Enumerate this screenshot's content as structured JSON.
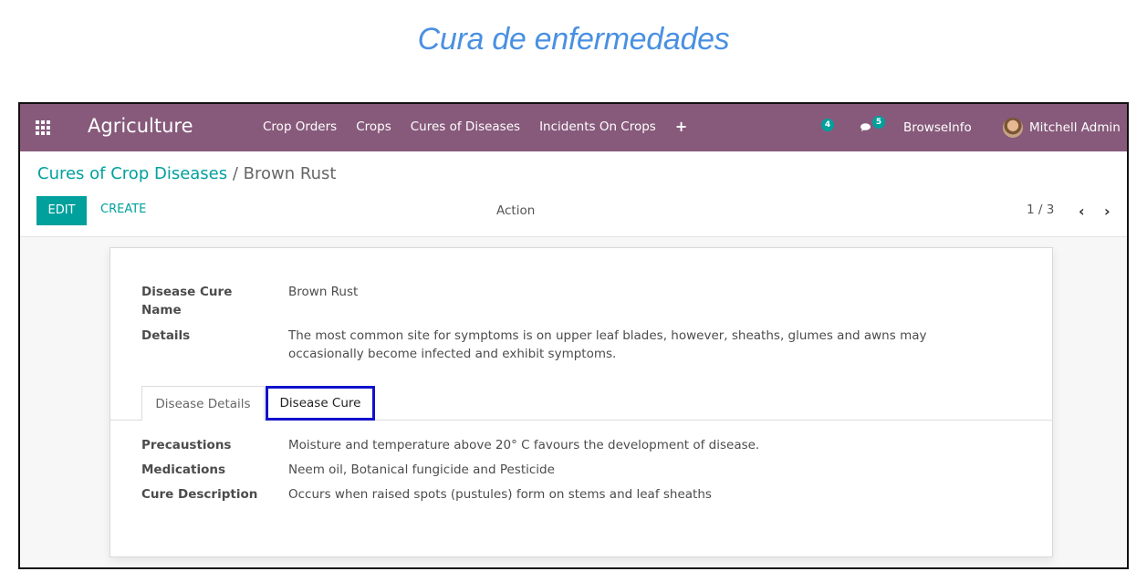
{
  "page": {
    "heading": "Cura de enfermedades"
  },
  "navbar": {
    "brand": "Agriculture",
    "menu": [
      "Crop Orders",
      "Crops",
      "Cures of Diseases",
      "Incidents On Crops"
    ],
    "add_icon": "+",
    "activity_count": "4",
    "message_count": "5",
    "company": "BrowseInfo",
    "user": "Mitchell Admin",
    "colors": {
      "bar": "#875a7b",
      "badge": "#00a09d"
    }
  },
  "control": {
    "breadcrumb_parent": "Cures of Crop Diseases",
    "breadcrumb_separator": " / ",
    "breadcrumb_current": "Brown Rust",
    "edit_label": "EDIT",
    "create_label": "CREATE",
    "action_label": "Action",
    "pager": "1 / 3",
    "prev_icon": "‹",
    "next_icon": "›"
  },
  "form": {
    "name_label_1": "Disease Cure",
    "name_label_2": "Name",
    "name_value": "Brown Rust",
    "details_label": "Details",
    "details_line_1": "The most common site for symptoms is on upper leaf blades, however, sheaths, glumes and awns may",
    "details_line_2": "occasionally become infected and exhibit symptoms.",
    "tabs": [
      "Disease Details",
      "Disease Cure"
    ],
    "active_tab": "Disease Cure",
    "precautions_label": "Precaustions",
    "precautions_value": "Moisture and temperature above 20° C favours the development of disease.",
    "medications_label": "Medications",
    "medications_value": "Neem oil, Botanical fungicide and Pesticide",
    "cure_description_label": "Cure Description",
    "cure_description_value": "Occurs when raised spots (pustules) form on stems and leaf sheaths"
  }
}
